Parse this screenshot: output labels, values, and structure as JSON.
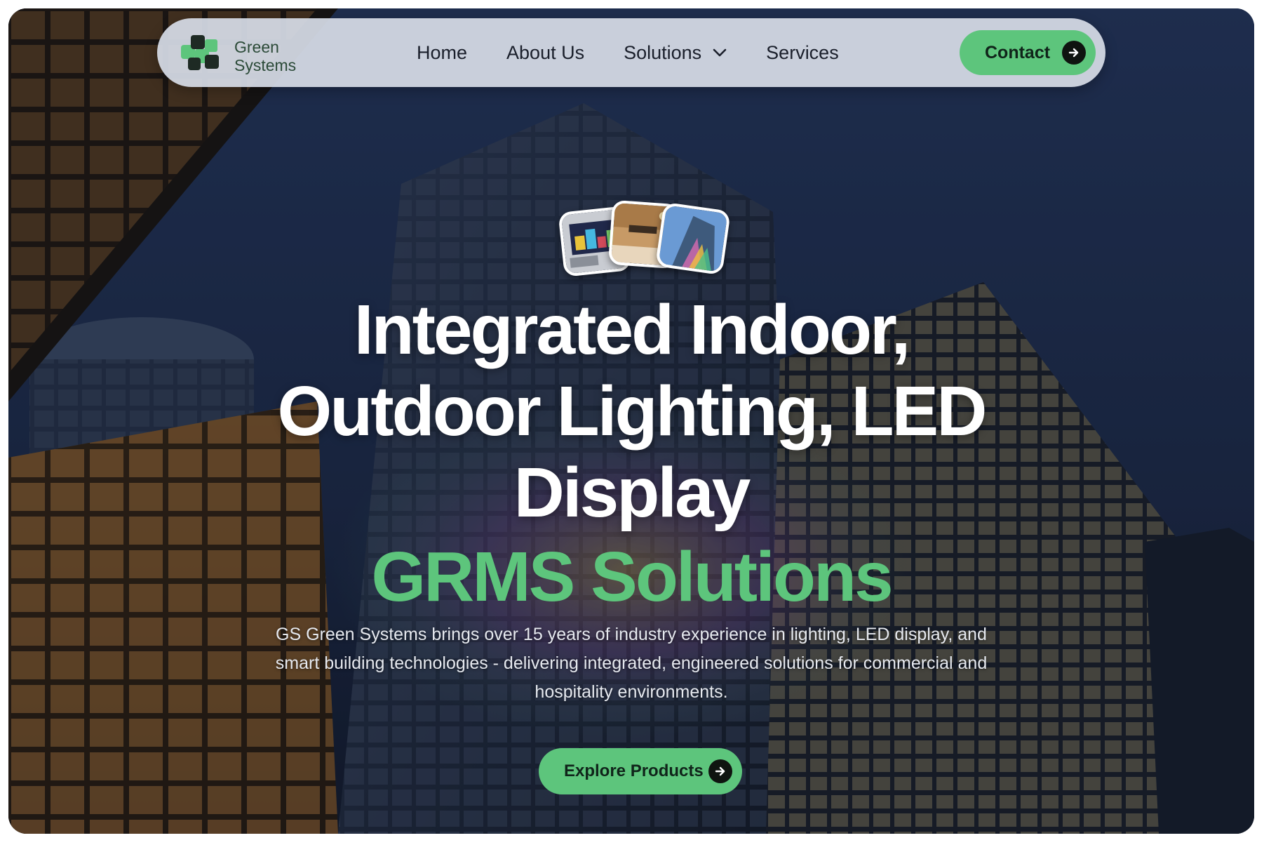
{
  "brand": {
    "name_line1": "Green",
    "name_line2": "Systems",
    "colors": {
      "accent": "#5dc57c",
      "nav_bg": "#d6dce6",
      "text_dark": "#1a1f2b"
    }
  },
  "nav": {
    "items": [
      {
        "label": "Home"
      },
      {
        "label": "About Us"
      },
      {
        "label": "Solutions",
        "icon": "chevron-down-icon"
      },
      {
        "label": "Services"
      }
    ],
    "contact_label": "Contact",
    "contact_icon": "arrow-right-icon"
  },
  "hero": {
    "thumbnails": [
      "led-display-photo",
      "room-interior-photo",
      "building-facade-photo"
    ],
    "headline_lines": [
      "Integrated Indoor,",
      "Outdoor Lighting, LED",
      "Display"
    ],
    "accent": "GRMS Solutions",
    "description": "GS Green Systems brings over 15 years of industry experience in lighting, LED display, and smart building technologies - delivering integrated, engineered solutions for commercial and hospitality environments.",
    "cta_label": "Explore Products",
    "cta_icon": "arrow-right-icon"
  }
}
